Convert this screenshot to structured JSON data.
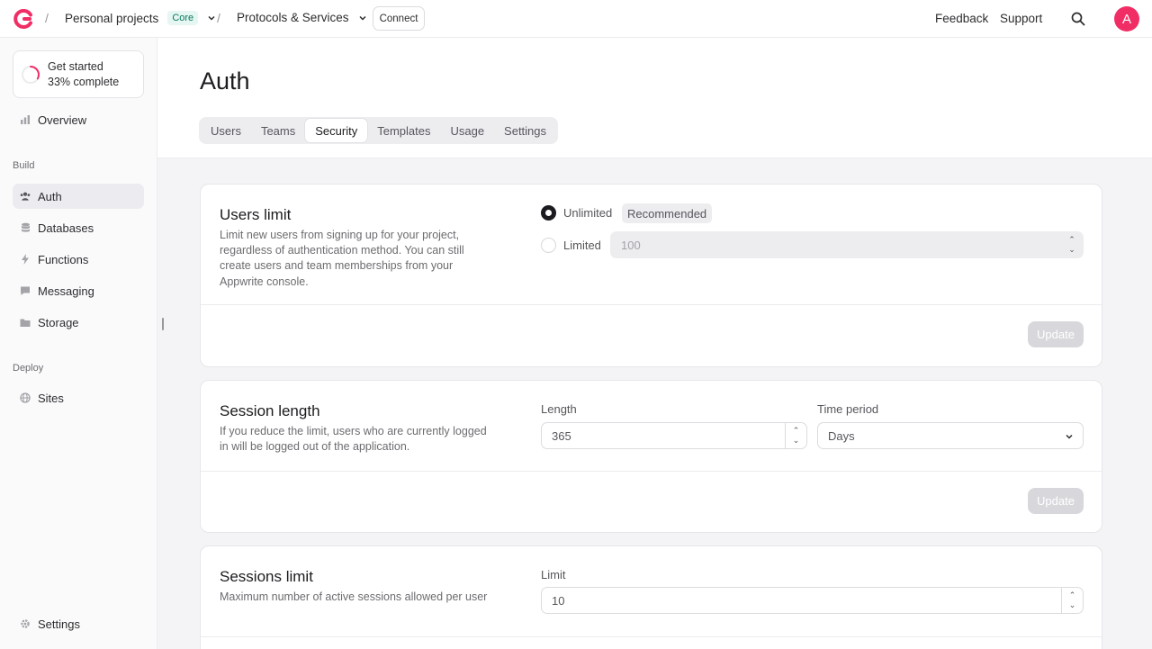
{
  "header": {
    "project": "Personal projects",
    "plan_badge": "Core",
    "service": "Protocols & Services",
    "connect_label": "Connect",
    "feedback_label": "Feedback",
    "support_label": "Support",
    "avatar_initial": "A",
    "brand_color": "#f02e65"
  },
  "sidebar": {
    "get_started_title": "Get started",
    "get_started_progress": "33% complete",
    "progress_fraction": 0.33,
    "overview": "Overview",
    "build_section": "Build",
    "items": [
      {
        "label": "Auth",
        "icon": "users-icon"
      },
      {
        "label": "Databases",
        "icon": "database-icon"
      },
      {
        "label": "Functions",
        "icon": "bolt-icon"
      },
      {
        "label": "Messaging",
        "icon": "chat-icon"
      },
      {
        "label": "Storage",
        "icon": "folder-icon"
      }
    ],
    "deploy_section": "Deploy",
    "sites": "Sites",
    "settings": "Settings"
  },
  "page": {
    "title": "Auth",
    "tabs": [
      "Users",
      "Teams",
      "Security",
      "Templates",
      "Usage",
      "Settings"
    ],
    "active_tab": "Security"
  },
  "users_limit": {
    "title": "Users limit",
    "description": "Limit new users from signing up for your project, regardless of authentication method. You can still create users and team memberships from your Appwrite console.",
    "option_unlimited": "Unlimited",
    "recommended_badge": "Recommended",
    "option_limited": "Limited",
    "limited_placeholder": "100",
    "update_label": "Update"
  },
  "session_length": {
    "title": "Session length",
    "description": "If you reduce the limit, users who are currently logged in will be logged out of the application.",
    "length_label": "Length",
    "length_value": "365",
    "period_label": "Time period",
    "period_value": "Days",
    "update_label": "Update"
  },
  "sessions_limit": {
    "title": "Sessions limit",
    "description": "Maximum number of active sessions allowed per user",
    "limit_label": "Limit",
    "limit_value": "10"
  }
}
